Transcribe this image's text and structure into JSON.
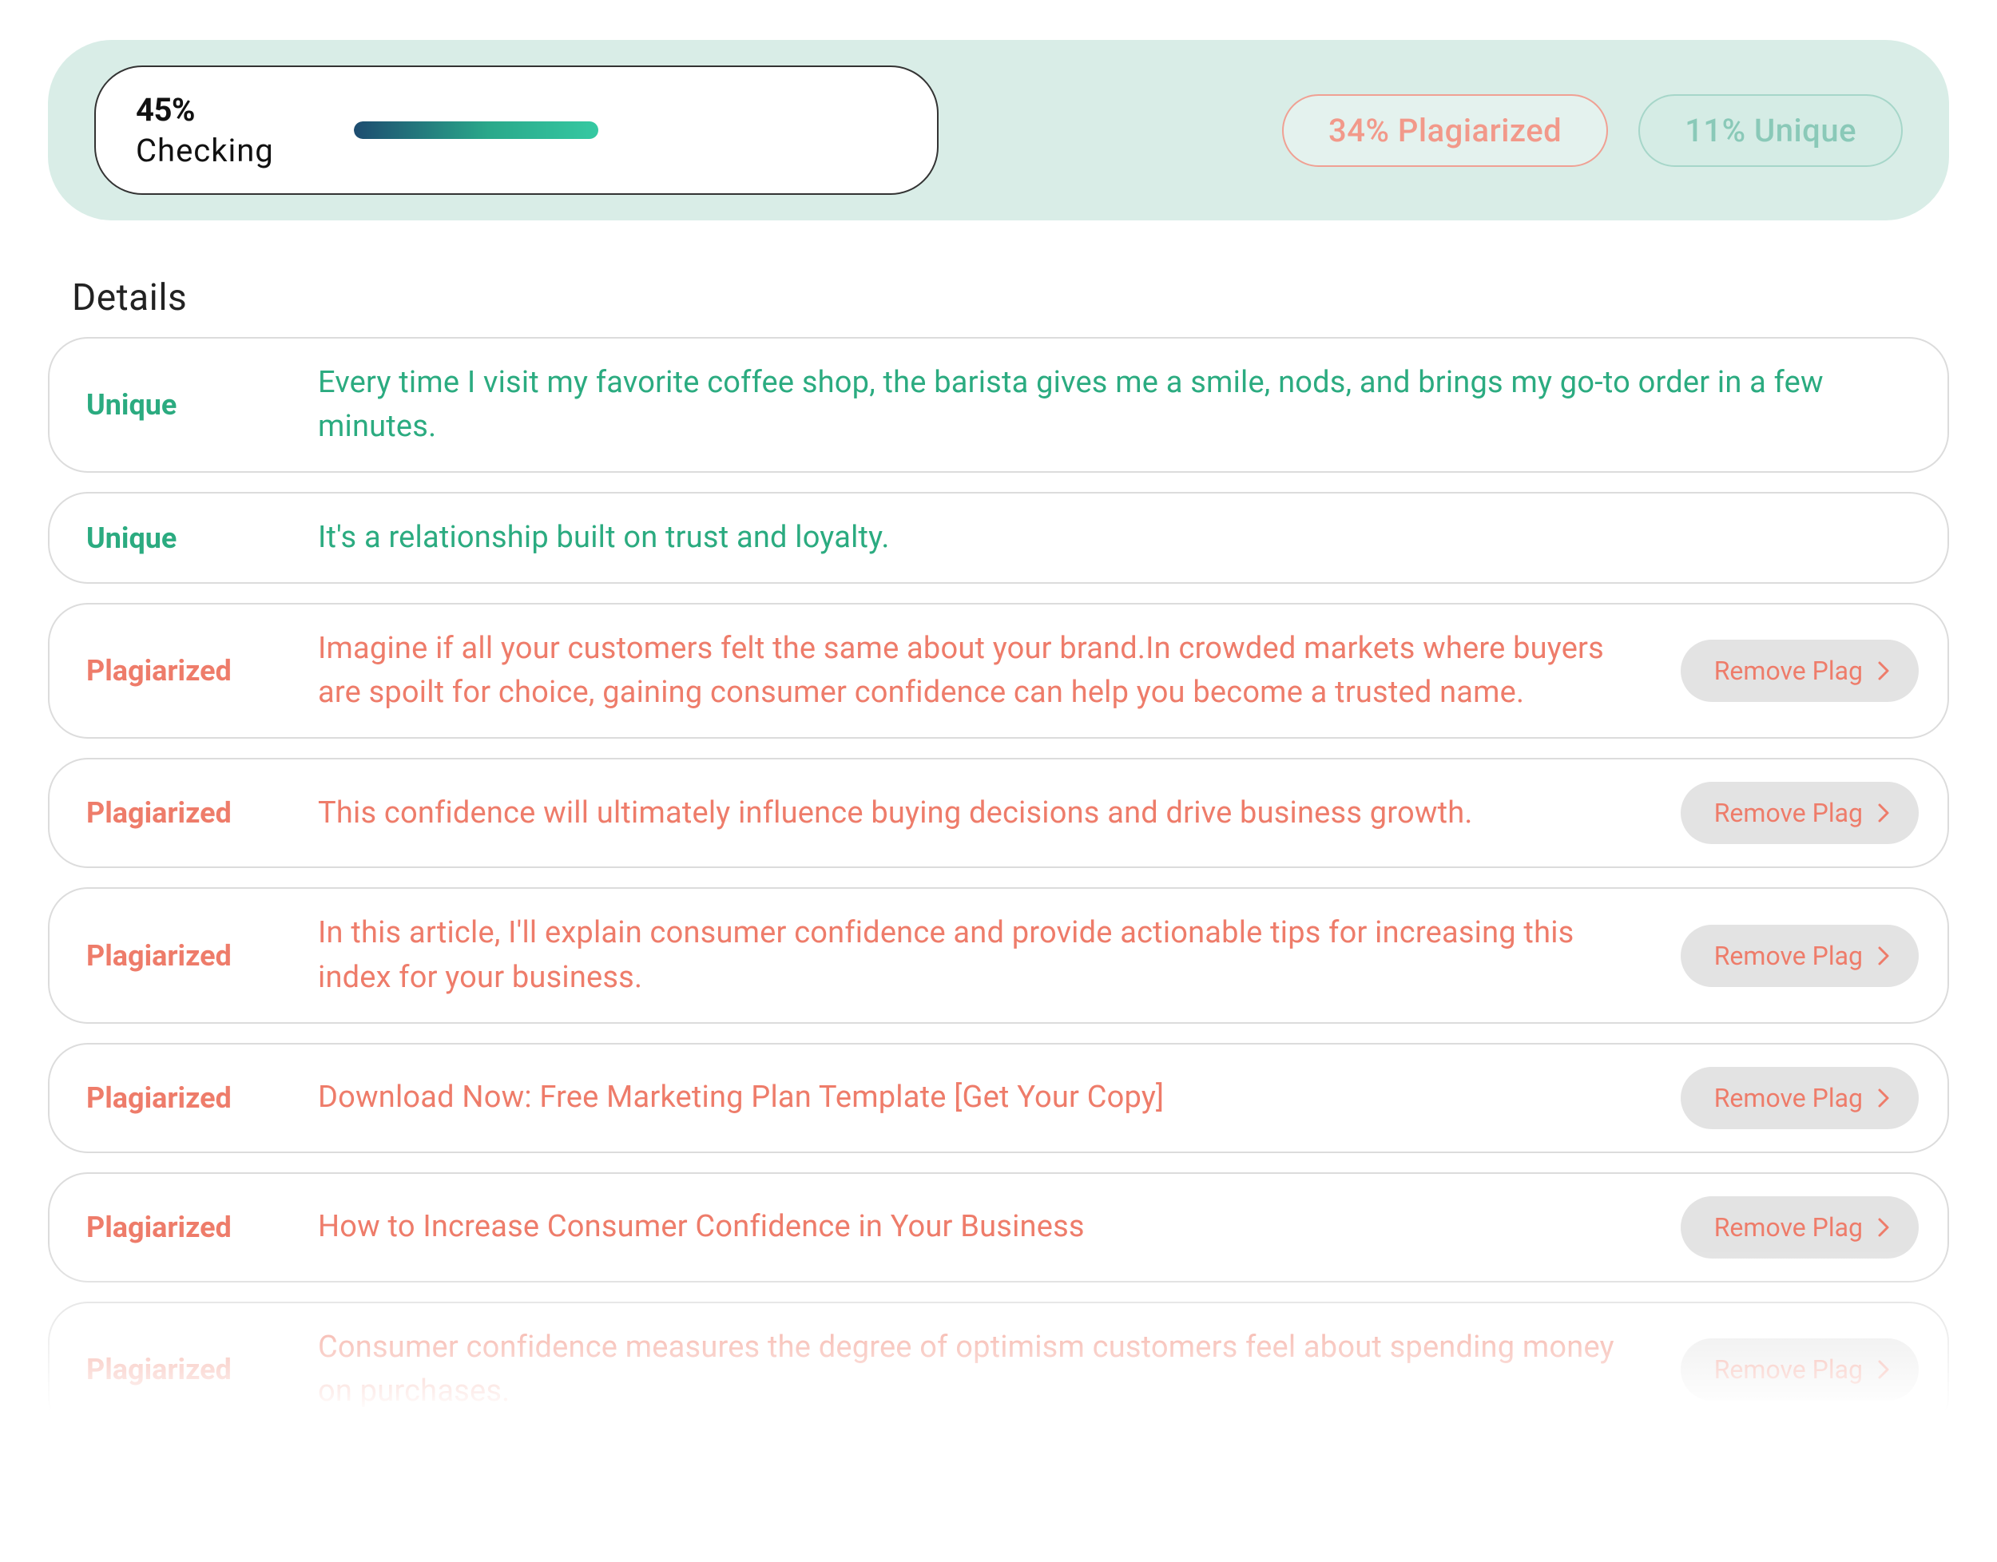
{
  "summary": {
    "percent_label": "45%",
    "status_label": "Checking",
    "progress_percent": 45,
    "plag_pill_text": "34%  Plagiarized",
    "unique_pill_text": "11%  Unique"
  },
  "details_heading": "Details",
  "status_labels": {
    "unique": "Unique",
    "plagiarized": "Plagiarized"
  },
  "remove_button_label": "Remove Plag",
  "rows": [
    {
      "status": "unique",
      "text": "Every time I visit my favorite coffee shop, the barista gives me a smile, nods, and brings my go-to order in a few minutes."
    },
    {
      "status": "unique",
      "text": "It's a relationship built on trust and loyalty."
    },
    {
      "status": "plag",
      "text": "Imagine if all your customers felt the same about your brand.In crowded markets where buyers are spoilt for choice, gaining consumer confidence can help you become a trusted name."
    },
    {
      "status": "plag",
      "text": "This confidence will ultimately influence buying decisions and drive business growth."
    },
    {
      "status": "plag",
      "text": "In this article, I'll explain consumer confidence and provide actionable tips for increasing this index for your business."
    },
    {
      "status": "plag",
      "text": "Download Now: Free Marketing Plan Template [Get Your Copy]"
    },
    {
      "status": "plag",
      "text": "How to Increase Consumer Confidence in Your Business"
    },
    {
      "status": "plag",
      "text": "Consumer confidence measures the degree of optimism customers feel about spending money on purchases."
    }
  ]
}
